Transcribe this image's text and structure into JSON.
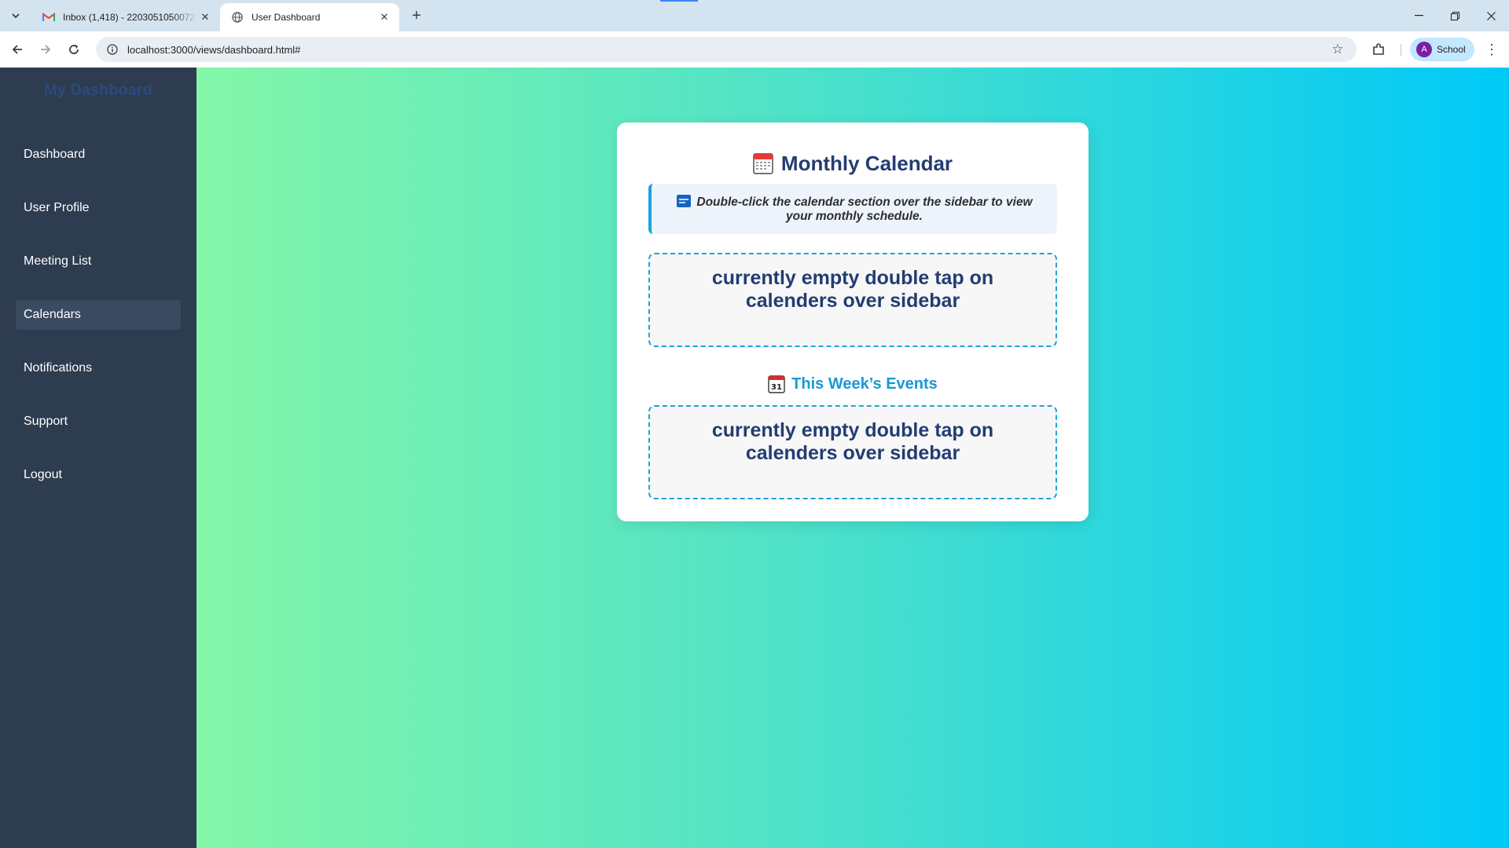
{
  "browser": {
    "tabs": [
      {
        "title": "Inbox (1,418) - 2203051050072",
        "icon": "gmail-icon",
        "active": false
      },
      {
        "title": "User Dashboard",
        "icon": "globe-icon",
        "active": true
      }
    ],
    "url": "localhost:3000/views/dashboard.html#",
    "profile": {
      "initial": "A",
      "label": "School"
    }
  },
  "sidebar": {
    "brand": "My Dashboard",
    "items": [
      {
        "label": "Dashboard",
        "active": false
      },
      {
        "label": "User Profile",
        "active": false
      },
      {
        "label": "Meeting List",
        "active": false
      },
      {
        "label": "Calendars",
        "active": true
      },
      {
        "label": "Notifications",
        "active": false
      },
      {
        "label": "Support",
        "active": false
      },
      {
        "label": "Logout",
        "active": false
      }
    ]
  },
  "main": {
    "title": "Monthly Calendar",
    "note": "Double-click the calendar section over the sidebar to view your monthly schedule.",
    "monthly_empty": "currently empty double tap on calenders over sidebar",
    "week_title": "This Week’s Events",
    "week_empty": "currently empty double tap on calenders over sidebar"
  },
  "colors": {
    "sidebar_bg": "#2e3c50",
    "title": "#233c73",
    "accent": "#1aa3e0",
    "gradient_start": "#84f7a8",
    "gradient_end": "#00c9f8"
  }
}
